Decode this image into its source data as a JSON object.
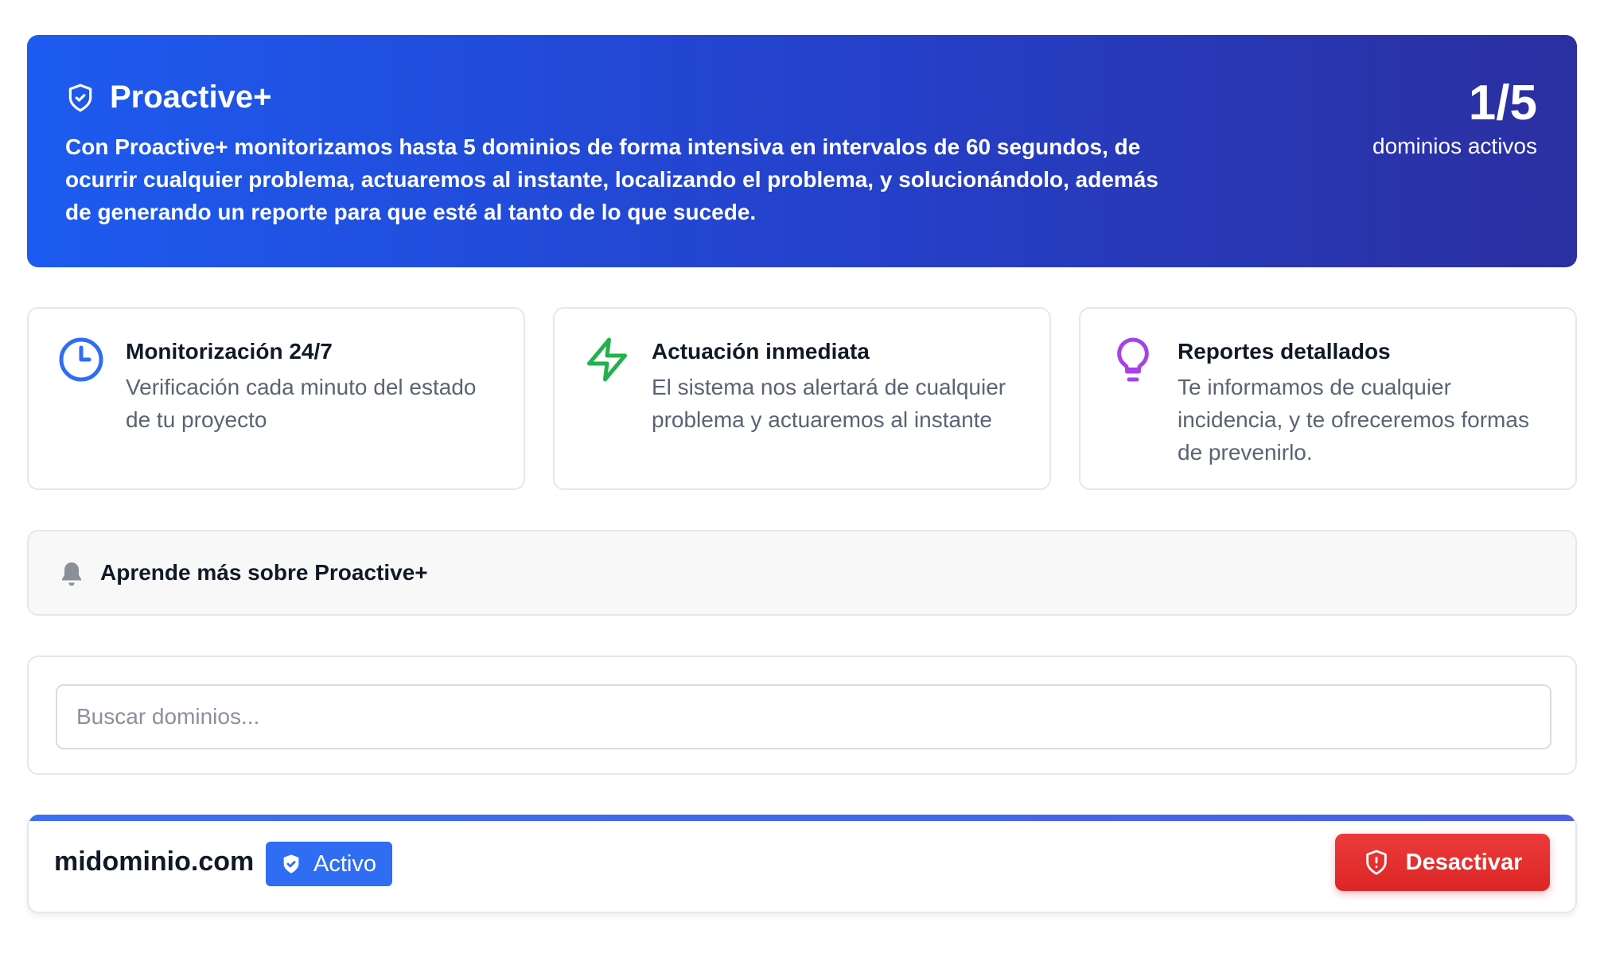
{
  "hero": {
    "icon": "shield-check-icon",
    "title": "Proactive+",
    "description": "Con Proactive+ monitorizamos hasta 5 dominios de forma intensiva en intervalos de 60 segundos, de ocurrir cualquier problema, actuaremos al instante, localizando el problema, y solucionándolo, además de generando un reporte para que esté al tanto de lo que sucede.",
    "count": "1/5",
    "count_label": "dominios activos"
  },
  "features": [
    {
      "icon": "clock-icon",
      "color": "#2f6ef3",
      "title": "Monitorización 24/7",
      "description": "Verificación cada minuto del estado de tu proyecto"
    },
    {
      "icon": "lightning-icon",
      "color": "#22b14c",
      "title": "Actuación inmediata",
      "description": "El sistema nos alertará de cualquier problema y actuaremos al instante"
    },
    {
      "icon": "lightbulb-icon",
      "color": "#a642e6",
      "title": "Reportes detallados",
      "description": "Te informamos de cualquier incidencia, y te ofreceremos formas de prevenirlo."
    }
  ],
  "learn_more": {
    "icon": "bell-icon",
    "label": "Aprende más sobre Proactive+"
  },
  "search": {
    "placeholder": "Buscar dominios...",
    "value": ""
  },
  "domains": [
    {
      "name": "midominio.com",
      "status": "Activo",
      "status_icon": "shield-check-icon",
      "action": "Desactivar",
      "action_icon": "shield-alert-icon"
    }
  ],
  "colors": {
    "accent": "#2f6ef3",
    "danger": "#dc2626",
    "hero_start": "#1d5bf0",
    "hero_end": "#2b2fa0"
  }
}
